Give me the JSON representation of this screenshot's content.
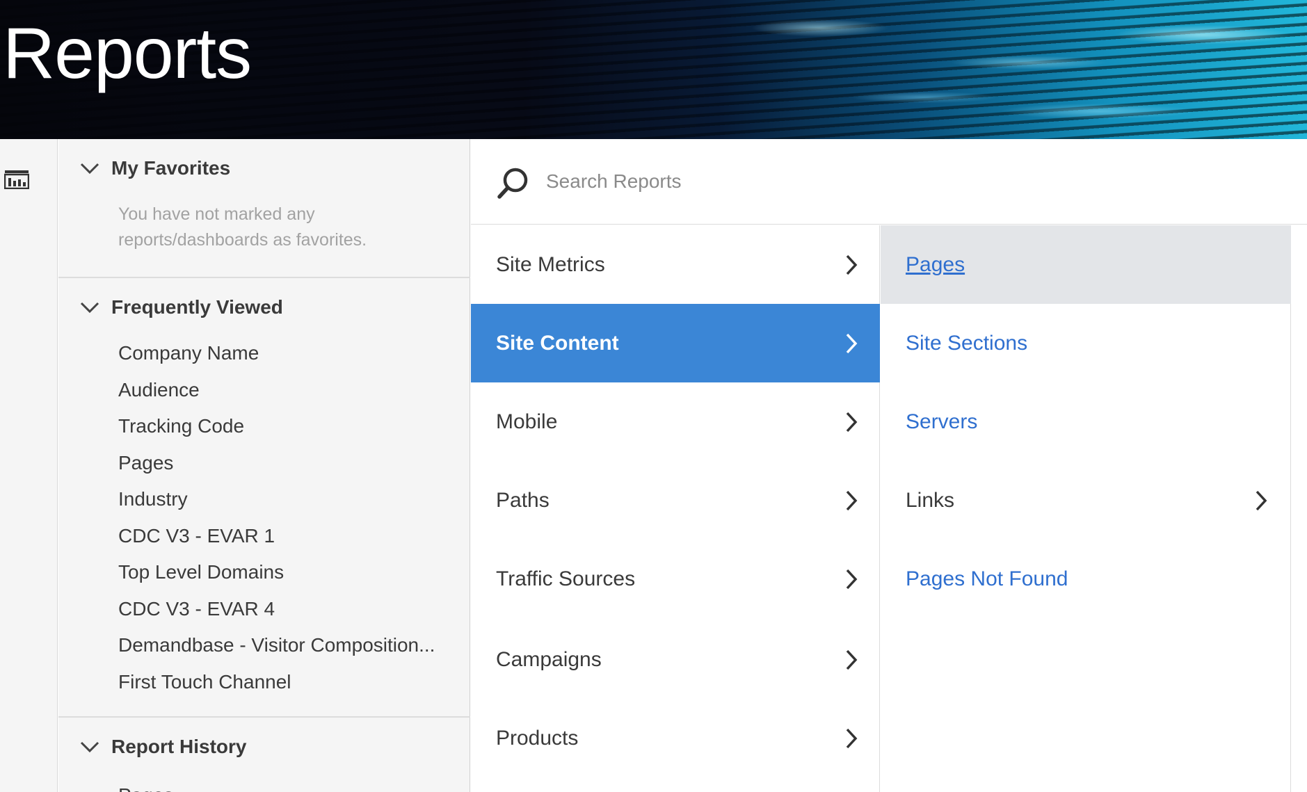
{
  "header": {
    "title": "Reports"
  },
  "rail": {
    "icon": "report-grid-icon"
  },
  "left_panel": {
    "favorites": {
      "heading": "My Favorites",
      "empty_line1": "You have not marked any",
      "empty_line2": "reports/dashboards as favorites."
    },
    "frequently_viewed": {
      "heading": "Frequently Viewed",
      "items": [
        "Company Name",
        "Audience",
        "Tracking Code",
        "Pages",
        "Industry",
        "CDC V3 - EVAR 1",
        "Top Level Domains",
        "CDC V3 - EVAR 4",
        "Demandbase - Visitor Composition...",
        "First Touch Channel"
      ]
    },
    "report_history": {
      "heading": "Report History",
      "first_item": "Pages"
    }
  },
  "search": {
    "placeholder": "Search Reports",
    "value": "",
    "icon": "search-icon"
  },
  "categories": {
    "items": [
      {
        "label": "Site Metrics",
        "active": false
      },
      {
        "label": "Site Content",
        "active": true
      },
      {
        "label": "Mobile",
        "active": false
      },
      {
        "label": "Paths",
        "active": false
      },
      {
        "label": "Traffic Sources",
        "active": false
      },
      {
        "label": "Campaigns",
        "active": false
      },
      {
        "label": "Products",
        "active": false
      }
    ]
  },
  "subcategories": {
    "items": [
      {
        "label": "Pages",
        "hover": true
      },
      {
        "label": "Site Sections"
      },
      {
        "label": "Servers"
      },
      {
        "label": "Links",
        "has_children": true
      },
      {
        "label": "Pages Not Found"
      }
    ]
  },
  "colors": {
    "active_bg": "#3b86d6",
    "link": "#2f6fcf",
    "hover_bg": "#e3e5e8",
    "panel_bg": "#f5f5f5"
  }
}
